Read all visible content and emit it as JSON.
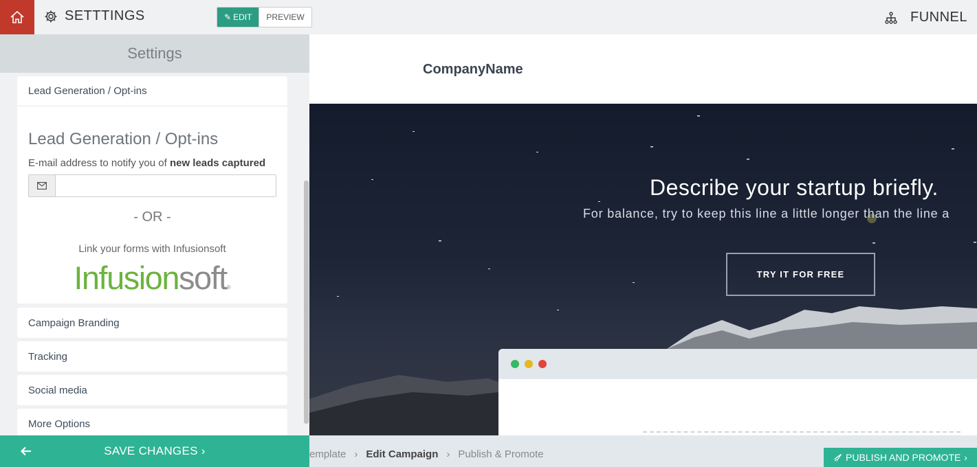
{
  "topbar": {
    "title": "SETTTINGS",
    "edit_label": "EDIT",
    "preview_label": "PREVIEW",
    "funnel_label": "FUNNEL"
  },
  "sidebar": {
    "header": "Settings",
    "open_panel": {
      "title": "Lead Generation / Opt-ins",
      "heading": "Lead Generation / Opt-ins",
      "email_label_prefix": "E-mail address to notify you of ",
      "email_label_bold": "new leads captured",
      "email_value": "",
      "or_text": "- OR -",
      "link_text": "Link your forms with Infusionsoft",
      "logo_part1": "Infusion",
      "logo_part2": "soft",
      "logo_mark": "®"
    },
    "panels": [
      "Campaign Branding",
      "Tracking",
      "Social media",
      "More Options"
    ],
    "save_label": "SAVE CHANGES"
  },
  "preview": {
    "company_name": "CompanyName",
    "headline": "Describe your startup briefly.",
    "subline": "For balance, try to keep this line a little longer than the line a",
    "cta_label": "TRY IT FOR FREE"
  },
  "bottombar": {
    "crumbs": [
      "emplate",
      "Edit Campaign",
      "Publish & Promote"
    ],
    "publish_label": "PUBLISH AND PROMOTE"
  },
  "colors": {
    "home_button": "#c0392b",
    "accent": "#2eb394",
    "logo_green": "#6db33f",
    "dot_green": "#35b962",
    "dot_yellow": "#e6b820",
    "dot_red": "#e2463a"
  }
}
